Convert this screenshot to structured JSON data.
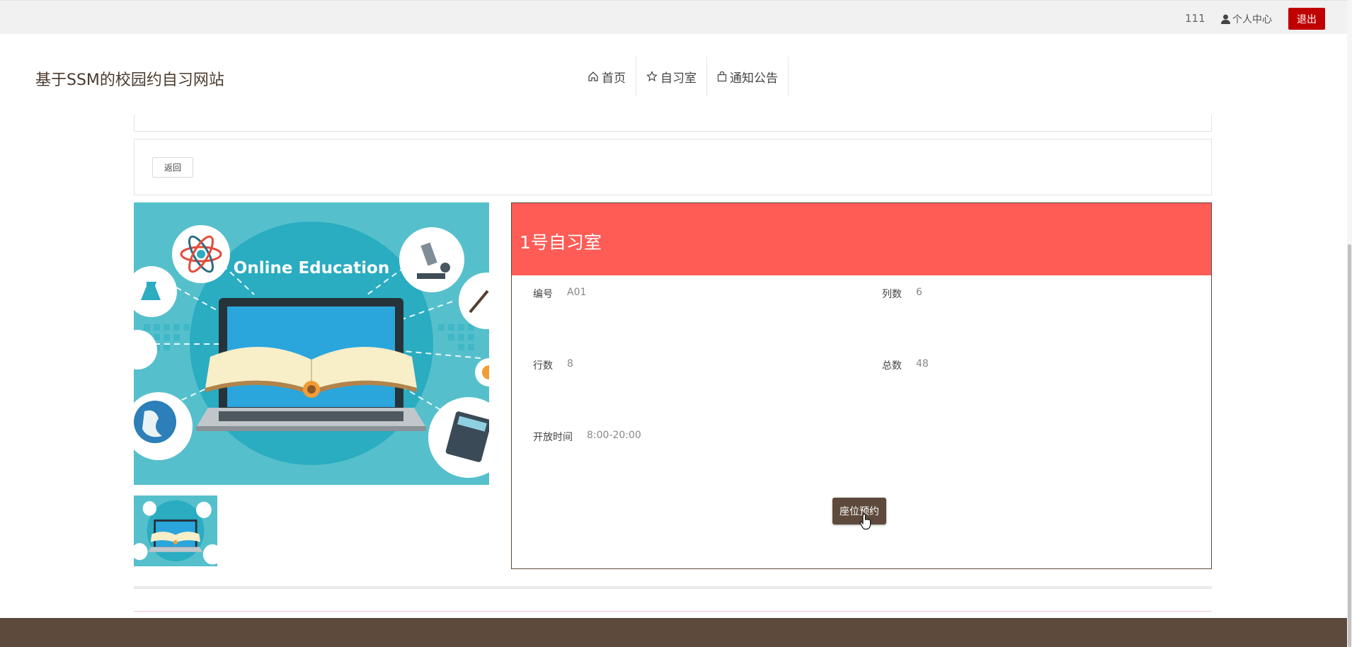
{
  "topbar": {
    "username": "111",
    "center_label": "个人中心",
    "logout_label": "退出"
  },
  "header": {
    "site_title": "基于SSM的校园约自习网站",
    "nav": [
      {
        "label": "首页",
        "icon": "home-icon"
      },
      {
        "label": "自习室",
        "icon": "star-icon"
      },
      {
        "label": "通知公告",
        "icon": "bag-icon"
      }
    ]
  },
  "back_label": "返回",
  "image": {
    "caption": "Online Education"
  },
  "room": {
    "title": "1号自习室",
    "fields": [
      {
        "key": "编号",
        "value": "A01"
      },
      {
        "key": "列数",
        "value": "6"
      },
      {
        "key": "行数",
        "value": "8"
      },
      {
        "key": "总数",
        "value": "48"
      },
      {
        "key": "开放时间",
        "value": "8:00-20:00"
      }
    ],
    "reserve_label": "座位预约"
  },
  "colors": {
    "accent": "#fe5c55",
    "brand": "#5e4a3c",
    "logout": "#c00000"
  }
}
